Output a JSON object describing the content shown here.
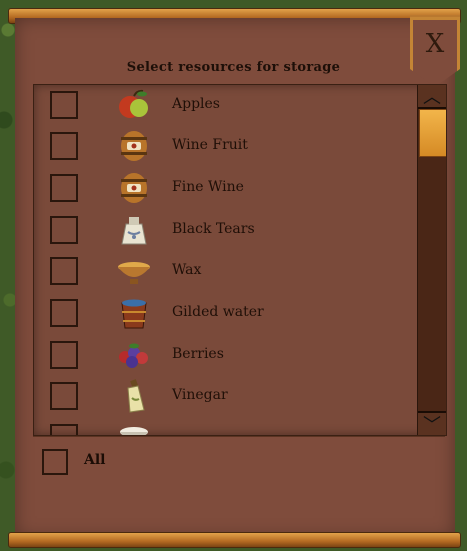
{
  "dialog": {
    "title": "Select resources for storage",
    "close_label": "X",
    "all_label": "All"
  },
  "resources": [
    {
      "label": "Apples",
      "icon": "apple-icon",
      "checked": false
    },
    {
      "label": "Wine Fruit",
      "icon": "barrel-icon",
      "checked": false
    },
    {
      "label": "Fine Wine",
      "icon": "barrel-icon",
      "checked": false
    },
    {
      "label": "Black Tears",
      "icon": "sack-icon",
      "checked": false
    },
    {
      "label": "Wax",
      "icon": "bowl-icon",
      "checked": false
    },
    {
      "label": "Gilded water",
      "icon": "bucket-icon",
      "checked": false
    },
    {
      "label": "Berries",
      "icon": "berries-icon",
      "checked": false
    },
    {
      "label": "Vinegar",
      "icon": "bottle-icon",
      "checked": false
    }
  ],
  "colors": {
    "panel": "#7f4c3c",
    "rail": "#c98336",
    "scroll_thumb": "#e9a53d"
  }
}
